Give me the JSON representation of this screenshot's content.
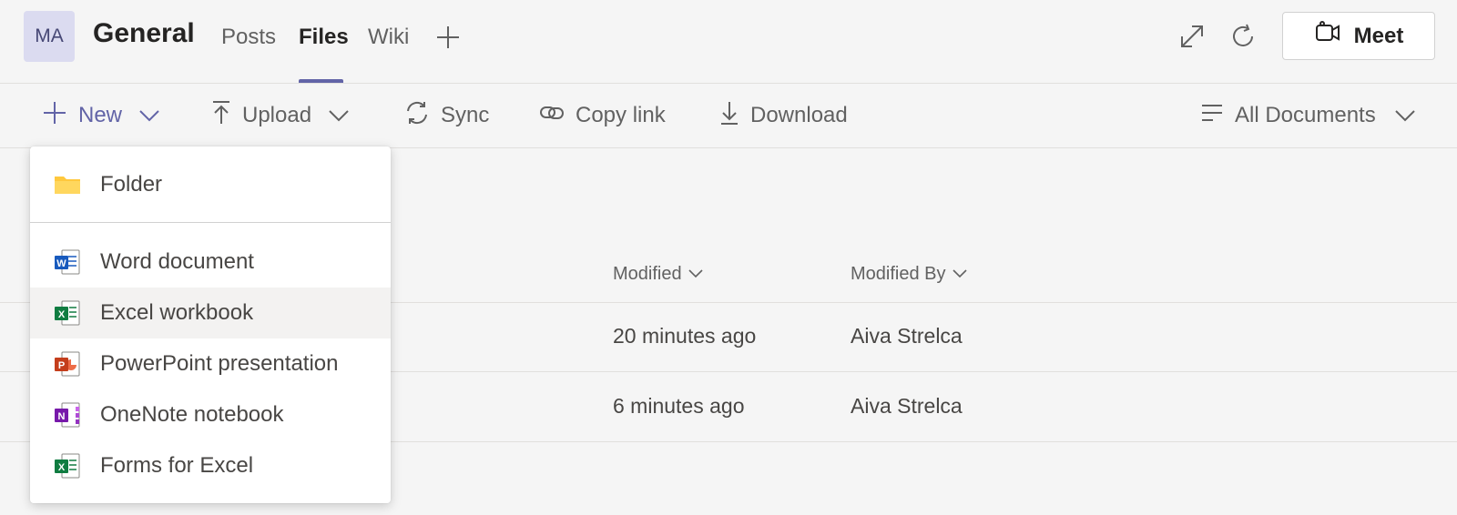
{
  "header": {
    "avatar_initials": "MA",
    "channel_title": "General",
    "tabs": [
      {
        "label": "Posts"
      },
      {
        "label": "Files"
      },
      {
        "label": "Wiki"
      }
    ],
    "add_tab_icon": "plus-icon",
    "expand_icon": "expand-icon",
    "refresh_icon": "refresh-icon",
    "meet_label": "Meet"
  },
  "commandbar": {
    "new_label": "New",
    "upload_label": "Upload",
    "sync_label": "Sync",
    "copy_link_label": "Copy link",
    "download_label": "Download",
    "view_label": "All Documents"
  },
  "table": {
    "columns": [
      {
        "label": "Modified"
      },
      {
        "label": "Modified By"
      }
    ],
    "rows": [
      {
        "modified": "20 minutes ago",
        "modified_by": "Aiva Strelca"
      },
      {
        "modified": "6 minutes ago",
        "modified_by": "Aiva Strelca"
      }
    ]
  },
  "new_menu": {
    "items": [
      {
        "label": "Folder",
        "icon": "folder-icon"
      },
      {
        "label": "Word document",
        "icon": "word-icon"
      },
      {
        "label": "Excel workbook",
        "icon": "excel-icon"
      },
      {
        "label": "PowerPoint presentation",
        "icon": "powerpoint-icon"
      },
      {
        "label": "OneNote notebook",
        "icon": "onenote-icon"
      },
      {
        "label": "Forms for Excel",
        "icon": "forms-excel-icon"
      }
    ],
    "hovered_item": "Excel workbook"
  },
  "colors": {
    "accent": "#6264a7",
    "background": "#f5f5f5",
    "word": "#185abd",
    "excel": "#107c41",
    "powerpoint": "#c43e1c",
    "onenote": "#7719aa",
    "folder": "#ffc83d"
  }
}
